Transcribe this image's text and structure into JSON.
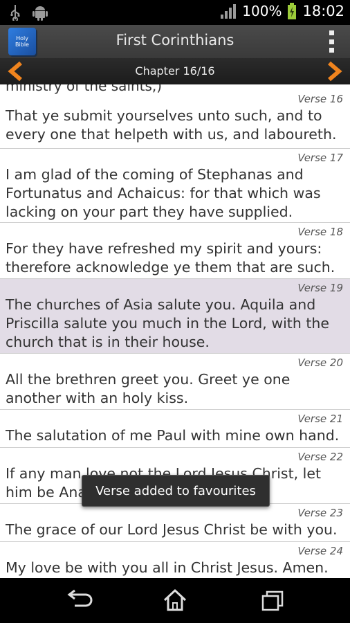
{
  "status_bar": {
    "battery": "100%",
    "time": "18:02"
  },
  "action_bar": {
    "app_icon_text": "Holy Bible",
    "title": "First Corinthians"
  },
  "chapter_bar": {
    "label": "Chapter 16/16"
  },
  "content": {
    "cut_text": "ministry of the saints,)",
    "verses": [
      {
        "number": "Verse 16",
        "text": "That ye submit yourselves unto such, and to every one that helpeth with us, and laboureth."
      },
      {
        "number": "Verse 17",
        "text": "I am glad of the coming of Stephanas and Fortunatus and Achaicus: for that which was lacking on your part they have supplied."
      },
      {
        "number": "Verse 18",
        "text": "For they have refreshed my spirit and yours: therefore acknowledge ye them that are such."
      },
      {
        "number": "Verse 19",
        "text": "The churches of Asia salute you. Aquila and Priscilla salute you much in the Lord, with the church that is in their house."
      },
      {
        "number": "Verse 20",
        "text": "All the brethren greet you. Greet ye one another with an holy kiss."
      },
      {
        "number": "Verse 21",
        "text": "The salutation of me Paul with mine own hand."
      },
      {
        "number": "Verse 22",
        "text": "If any man love not the Lord Jesus Christ, let him be Anathema Maranatha."
      },
      {
        "number": "Verse 23",
        "text": "The grace of our Lord Jesus Christ be with you."
      },
      {
        "number": "Verse 24",
        "text": "My love be with you all in Christ Jesus. Amen."
      }
    ]
  },
  "toast": {
    "message": "Verse added to favourites"
  },
  "colors": {
    "accent_arrow": "#f0841e",
    "highlight": "#e2dce6",
    "battery": "#9ccc3a"
  }
}
